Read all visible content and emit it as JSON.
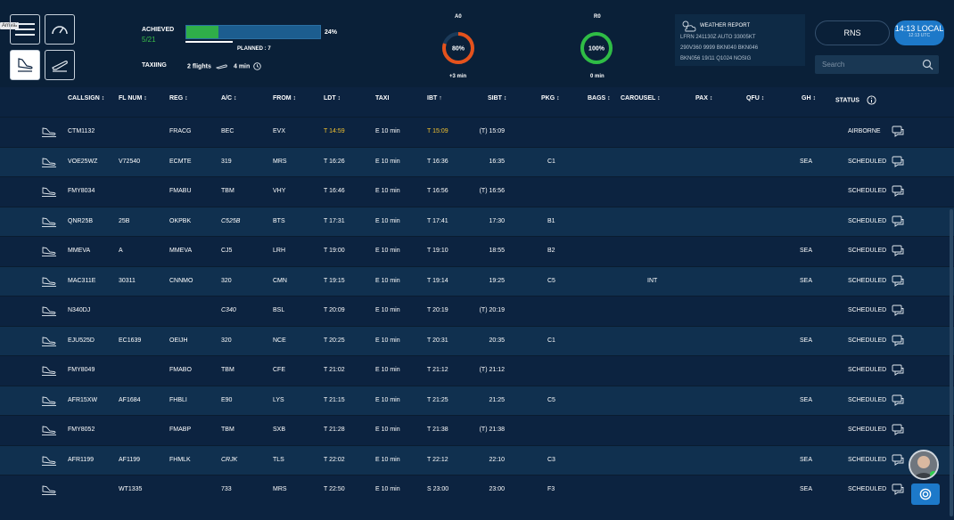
{
  "nav": {
    "arrival_tag": "Arrival"
  },
  "summary": {
    "achieved_label": "ACHIEVED",
    "achieved_value": "5/21",
    "progress_percent": 24,
    "percent_label": "24%",
    "planned_label": "PLANNED : 7",
    "taxiing_label": "TAXIING",
    "taxiing_flights": "2 flights",
    "taxiing_time": "4 min",
    "accent_green": "#2fae49",
    "accent_blue": "#1c5d8f"
  },
  "gauges": [
    {
      "title": "A0",
      "value": "80%",
      "percent": 80,
      "sub": "+3 min",
      "color": "#e5521c"
    },
    {
      "title": "R0",
      "value": "100%",
      "percent": 100,
      "sub": "0 min",
      "color": "#2fbd45"
    }
  ],
  "weather": {
    "title": "WEATHER REPORT",
    "lines": [
      "LFRN 241130Z AUTO 33005KT",
      "290V360 9999 BKN040 BKN046",
      "BKN056 19/11 Q1024 NOSIG"
    ]
  },
  "controls": {
    "airport": "RNS",
    "local_time": "14:13 LOCAL",
    "utc_time": "12:13 UTC",
    "search_placeholder": "Search"
  },
  "columns": [
    {
      "label": "CALLSIGN ↕"
    },
    {
      "label": "FL NUM ↕"
    },
    {
      "label": "REG ↕"
    },
    {
      "label": "A/C ↕"
    },
    {
      "label": "FROM ↕"
    },
    {
      "label": "LDT ↕"
    },
    {
      "label": "TAXI"
    },
    {
      "label": "IBT ↑"
    },
    {
      "label": "SIBT ↕"
    },
    {
      "label": "PKG ↕"
    },
    {
      "label": "BAGS ↕"
    },
    {
      "label": "CAROUSEL ↕"
    },
    {
      "label": "PAX ↕"
    },
    {
      "label": "QFU ↕"
    },
    {
      "label": "GH ↕"
    },
    {
      "label": "STATUS"
    }
  ],
  "flights": [
    {
      "callsign": "CTM1132",
      "flnum": "",
      "reg": "FRACG",
      "ac": "BEC",
      "from": "EVX",
      "ldt": "T 14:59",
      "taxi": "E 10 min",
      "ibt": "T 15:09",
      "sibt": "(T) 15:09",
      "pkg": "",
      "carousel": "",
      "gh": "",
      "status": "AIRBORNE"
    },
    {
      "callsign": "VOE25WZ",
      "flnum": "V72540",
      "reg": "ECMTE",
      "ac": "319",
      "from": "MRS",
      "ldt": "T 16:26",
      "taxi": "E 10 min",
      "ibt": "T 16:36",
      "sibt": "16:35",
      "pkg": "C1",
      "carousel": "",
      "gh": "SEA",
      "status": "SCHEDULED"
    },
    {
      "callsign": "FMY8034",
      "flnum": "",
      "reg": "FMABU",
      "ac": "TBM",
      "from": "VHY",
      "ldt": "T 16:46",
      "taxi": "E 10 min",
      "ibt": "T 16:56",
      "sibt": "(T) 16:56",
      "pkg": "",
      "carousel": "",
      "gh": "",
      "status": "SCHEDULED"
    },
    {
      "callsign": "QNR25B",
      "flnum": "25B",
      "reg": "OKPBK",
      "ac": "C525B",
      "from": "BTS",
      "ldt": "T 17:31",
      "taxi": "E 10 min",
      "ibt": "T 17:41",
      "sibt": "17:30",
      "pkg": "B1",
      "carousel": "",
      "gh": "",
      "status": "SCHEDULED"
    },
    {
      "callsign": "MMEVA",
      "flnum": "A",
      "reg": "MMEVA",
      "ac": "CJ5",
      "from": "LRH",
      "ldt": "T 19:00",
      "taxi": "E 10 min",
      "ibt": "T 19:10",
      "sibt": "18:55",
      "pkg": "B2",
      "carousel": "",
      "gh": "SEA",
      "status": "SCHEDULED"
    },
    {
      "callsign": "MAC311E",
      "flnum": "30311",
      "reg": "CNNMO",
      "ac": "320",
      "from": "CMN",
      "ldt": "T 19:15",
      "taxi": "E 10 min",
      "ibt": "T 19:14",
      "sibt": "19:25",
      "pkg": "C5",
      "carousel": "INT",
      "gh": "SEA",
      "status": "SCHEDULED"
    },
    {
      "callsign": "N340DJ",
      "flnum": "",
      "reg": "",
      "ac": "C340",
      "from": "BSL",
      "ldt": "T 20:09",
      "taxi": "E 10 min",
      "ibt": "T 20:19",
      "sibt": "(T) 20:19",
      "pkg": "",
      "carousel": "",
      "gh": "",
      "status": "SCHEDULED"
    },
    {
      "callsign": "EJU525D",
      "flnum": "EC1639",
      "reg": "OEIJH",
      "ac": "320",
      "from": "NCE",
      "ldt": "T 20:25",
      "taxi": "E 10 min",
      "ibt": "T 20:31",
      "sibt": "20:35",
      "pkg": "C1",
      "carousel": "",
      "gh": "SEA",
      "status": "SCHEDULED"
    },
    {
      "callsign": "FMY8049",
      "flnum": "",
      "reg": "FMABO",
      "ac": "TBM",
      "from": "CFE",
      "ldt": "T 21:02",
      "taxi": "E 10 min",
      "ibt": "T 21:12",
      "sibt": "(T) 21:12",
      "pkg": "",
      "carousel": "",
      "gh": "",
      "status": "SCHEDULED"
    },
    {
      "callsign": "AFR15XW",
      "flnum": "AF1684",
      "reg": "FHBLI",
      "ac": "E90",
      "from": "LYS",
      "ldt": "T 21:15",
      "taxi": "E 10 min",
      "ibt": "T 21:25",
      "sibt": "21:25",
      "pkg": "C5",
      "carousel": "",
      "gh": "SEA",
      "status": "SCHEDULED"
    },
    {
      "callsign": "FMY8052",
      "flnum": "",
      "reg": "FMABP",
      "ac": "TBM",
      "from": "SXB",
      "ldt": "T 21:28",
      "taxi": "E 10 min",
      "ibt": "T 21:38",
      "sibt": "(T) 21:38",
      "pkg": "",
      "carousel": "",
      "gh": "",
      "status": "SCHEDULED"
    },
    {
      "callsign": "AFR1199",
      "flnum": "AF1199",
      "reg": "FHMLK",
      "ac": "CRJK",
      "from": "TLS",
      "ldt": "T 22:02",
      "taxi": "E 10 min",
      "ibt": "T 22:12",
      "sibt": "22:10",
      "pkg": "C3",
      "carousel": "",
      "gh": "SEA",
      "status": "SCHEDULED"
    },
    {
      "callsign": "",
      "flnum": "WT1335",
      "reg": "",
      "ac": "733",
      "from": "MRS",
      "ldt": "T 22:50",
      "taxi": "E 10 min",
      "ibt": "S 23:00",
      "sibt": "23:00",
      "pkg": "F3",
      "carousel": "",
      "gh": "SEA",
      "status": "SCHEDULED"
    }
  ]
}
